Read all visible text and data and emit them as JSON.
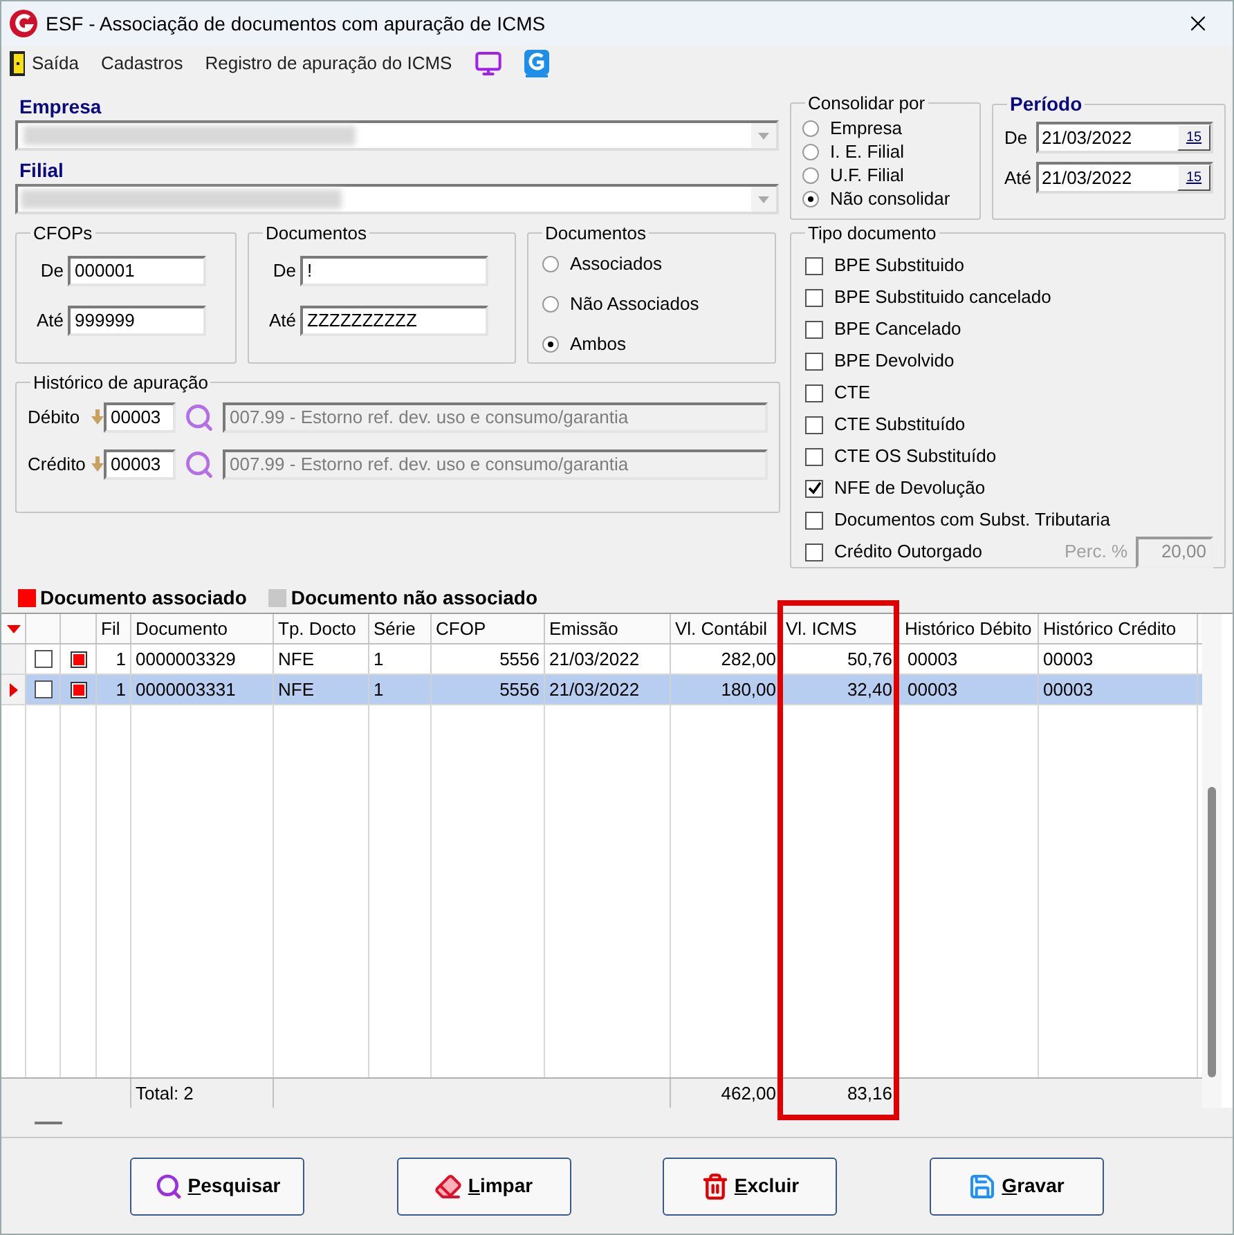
{
  "window": {
    "title": "ESF - Associação de documentos com apuração de ICMS"
  },
  "menu": [
    {
      "label": "Saída",
      "kind": "exit"
    },
    {
      "label": "Cadastros",
      "kind": "text"
    },
    {
      "label": "Registro de apuração do ICMS",
      "kind": "text"
    },
    {
      "kind": "monitor"
    },
    {
      "kind": "logo"
    }
  ],
  "empresa": {
    "label": "Empresa"
  },
  "filial": {
    "label": "Filial"
  },
  "cfops": {
    "title": "CFOPs",
    "fields": [
      {
        "label": "De",
        "value": "000001"
      },
      {
        "label": "Até",
        "value": "999999"
      }
    ]
  },
  "documentos_range": {
    "title": "Documentos",
    "fields": [
      {
        "label": "De",
        "value": "!"
      },
      {
        "label": "Até",
        "value": "ZZZZZZZZZZ"
      }
    ]
  },
  "documentos_filter": {
    "title": "Documentos",
    "options": [
      {
        "label": "Associados",
        "selected": false
      },
      {
        "label": "Não Associados",
        "selected": false
      },
      {
        "label": "Ambos",
        "selected": true
      }
    ]
  },
  "historico": {
    "title": "Histórico de apuração",
    "rows": [
      {
        "label": "Débito",
        "code": "00003",
        "description": "007.99 - Estorno ref. dev. uso e consumo/garantia"
      },
      {
        "label": "Crédito",
        "code": "00003",
        "description": "007.99 - Estorno ref. dev. uso e consumo/garantia"
      }
    ]
  },
  "consolidar": {
    "title": "Consolidar por",
    "options": [
      {
        "label": "Empresa",
        "selected": false
      },
      {
        "label": "I. E. Filial",
        "selected": false
      },
      {
        "label": "U.F. Filial",
        "selected": false
      },
      {
        "label": "Não consolidar",
        "selected": true
      }
    ]
  },
  "periodo": {
    "title": "Período",
    "fields": [
      {
        "label": "De",
        "value": "21/03/2022",
        "calendar_label": "15"
      },
      {
        "label": "Até",
        "value": "21/03/2022",
        "calendar_label": "15"
      }
    ]
  },
  "tipo_documento": {
    "title": "Tipo documento",
    "items": [
      {
        "label": "BPE Substituido",
        "checked": false
      },
      {
        "label": "BPE Substituido cancelado",
        "checked": false
      },
      {
        "label": "BPE Cancelado",
        "checked": false
      },
      {
        "label": "BPE Devolvido",
        "checked": false
      },
      {
        "label": "CTE",
        "checked": false
      },
      {
        "label": "CTE Substituído",
        "checked": false
      },
      {
        "label": "CTE OS Substituído",
        "checked": false
      },
      {
        "label": "NFE de Devolução",
        "checked": true
      },
      {
        "label": "Documentos com Subst. Tributaria",
        "checked": false
      },
      {
        "label": "Crédito Outorgado",
        "checked": false
      }
    ],
    "perc": {
      "label": "Perc. %",
      "value": "20,00",
      "disabled": true
    }
  },
  "legend": [
    {
      "label": "Documento associado",
      "color": "#ff0000"
    },
    {
      "label": "Documento não associado",
      "color": "#c8c8c8"
    }
  ],
  "table": {
    "columns": [
      "Fil",
      "Documento",
      "Tp. Docto",
      "Série",
      "CFOP",
      "Emissão",
      "Vl. Contábil",
      "Vl. ICMS",
      "Histórico Débito",
      "Histórico Crédito"
    ],
    "rows": [
      {
        "selected": false,
        "checked": false,
        "color": "#ff0000",
        "cells": [
          "1",
          "0000003329",
          "NFE",
          "1",
          "5556",
          "21/03/2022",
          "282,00",
          "50,76",
          "00003",
          "00003"
        ]
      },
      {
        "selected": true,
        "checked": false,
        "color": "#ff0000",
        "cells": [
          "1",
          "0000003331",
          "NFE",
          "1",
          "5556",
          "21/03/2022",
          "180,00",
          "32,40",
          "00003",
          "00003"
        ]
      }
    ],
    "totals": {
      "label": "Total: 2",
      "vl_contabil": "462,00",
      "vl_icms": "83,16"
    }
  },
  "buttons": [
    {
      "label": "Pesquisar",
      "kind": "search"
    },
    {
      "label": "Limpar",
      "kind": "clear"
    },
    {
      "label": "Excluir",
      "kind": "delete"
    },
    {
      "label": "Gravar",
      "kind": "save"
    }
  ]
}
